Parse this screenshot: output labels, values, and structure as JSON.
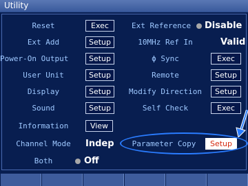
{
  "window": {
    "title": "Utility"
  },
  "left": {
    "reset": {
      "label": "Reset",
      "button": "Exec"
    },
    "ext_add": {
      "label": "Ext Add",
      "button": "Setup"
    },
    "power_on_output": {
      "label": "Power-On Output",
      "button": "Setup"
    },
    "user_unit": {
      "label": "User Unit",
      "button": "Setup"
    },
    "display": {
      "label": "Display",
      "button": "Setup"
    },
    "sound": {
      "label": "Sound",
      "button": "Setup"
    },
    "information": {
      "label": "Information",
      "button": "View"
    },
    "channel_mode": {
      "label": "Channel Mode",
      "value": "Indep"
    },
    "both": {
      "label": "Both",
      "value": "Off"
    }
  },
  "right": {
    "ext_reference": {
      "label": "Ext Reference",
      "value": "Disable"
    },
    "ref_in_10mhz": {
      "label": "10MHz Ref In",
      "value": "Valid"
    },
    "phase_sync": {
      "label": "ϕ Sync",
      "button": "Exec"
    },
    "remote": {
      "label": "Remote",
      "button": "Setup"
    },
    "modify_direction": {
      "label": "Modify Direction",
      "button": "Setup"
    },
    "self_check": {
      "label": "Self Check",
      "button": "Exec"
    },
    "parameter_copy": {
      "label": "Parameter Copy",
      "button": "Setup"
    }
  },
  "colors": {
    "background": "#081e50",
    "label": "#9ec8ff",
    "highlight_button_text": "#d42a10",
    "annotation": "#2a7cff"
  },
  "softkeys": [
    "",
    "",
    "",
    "",
    "",
    ""
  ]
}
